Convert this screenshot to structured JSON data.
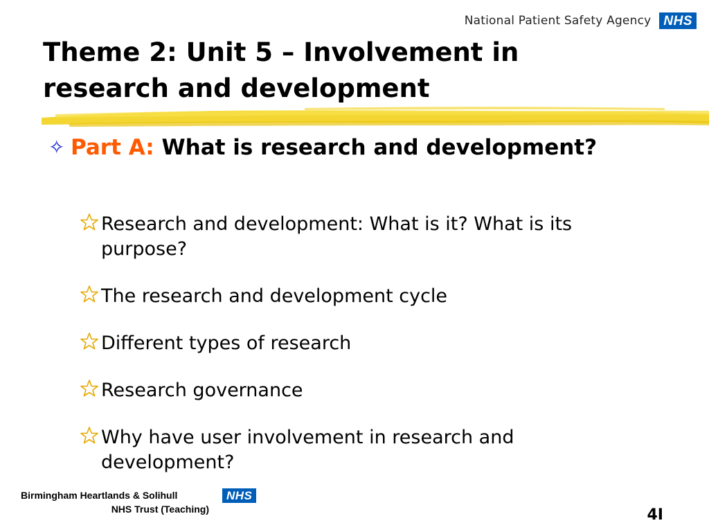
{
  "header": {
    "agency": "National Patient Safety Agency",
    "nhs_logo": "NHS"
  },
  "title": {
    "line1": "Theme 2: Unit 5 – Involvement in",
    "line2": "research and development"
  },
  "main_bullet": {
    "icon": "diamond-outline-icon",
    "part_label": "Part A:",
    "text": " What is research and development?"
  },
  "sub_bullets": [
    {
      "icon": "star-outline-icon",
      "text": "Research and development: What is it? What is its purpose?"
    },
    {
      "icon": "star-outline-icon",
      "text": "The research and development cycle"
    },
    {
      "icon": "star-outline-icon",
      "text": "Different types of research"
    },
    {
      "icon": "star-outline-icon",
      "text": "Research governance"
    },
    {
      "icon": "star-outline-icon",
      "text": "Why have user involvement in research and development?"
    }
  ],
  "footer": {
    "trust_line1": "Birmingham Heartlands & Solihull",
    "trust_line2": "NHS Trust (Teaching)",
    "nhs_logo": "NHS",
    "slide_number": "4I"
  },
  "colors": {
    "accent_orange": "#ff5a00",
    "bullet_blue": "#1a2dd6",
    "highlight_yellow": "#f2d21b",
    "nhs_blue": "#005EB8"
  }
}
